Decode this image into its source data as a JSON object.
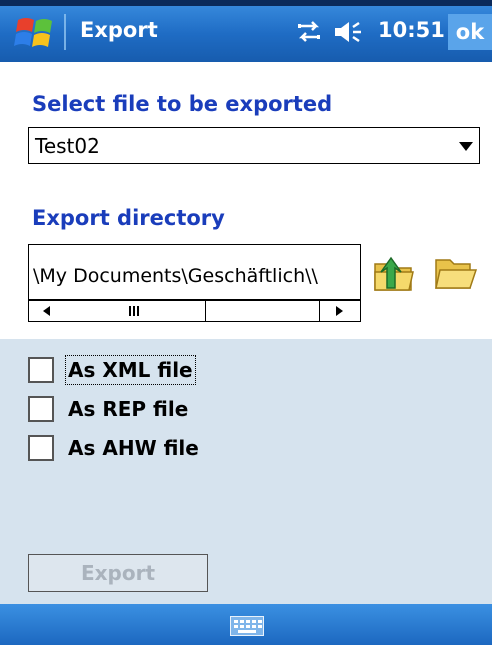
{
  "titlebar": {
    "title": "Export",
    "time": "10:51",
    "ok_label": "ok",
    "icons": [
      "windows-start-icon",
      "connectivity-icon",
      "volume-icon"
    ]
  },
  "file_select": {
    "label": "Select file to be exported",
    "selected": "Test02"
  },
  "directory": {
    "label": "Export directory",
    "value": "\\My Documents\\Geschäftlich\\\\",
    "buttons": [
      "up-folder-icon",
      "open-folder-icon"
    ]
  },
  "options": [
    {
      "label": "As XML file",
      "checked": false,
      "focused": true
    },
    {
      "label": "As REP file",
      "checked": false,
      "focused": false
    },
    {
      "label": "As AHW file",
      "checked": false,
      "focused": false
    }
  ],
  "export_button": {
    "label": "Export",
    "enabled": false
  },
  "bottombar": {
    "icon": "keyboard-icon"
  },
  "colors": {
    "accent_blue": "#1f6cc4",
    "label_blue": "#1a3dbb",
    "panel_bg": "#d6e3ee"
  }
}
